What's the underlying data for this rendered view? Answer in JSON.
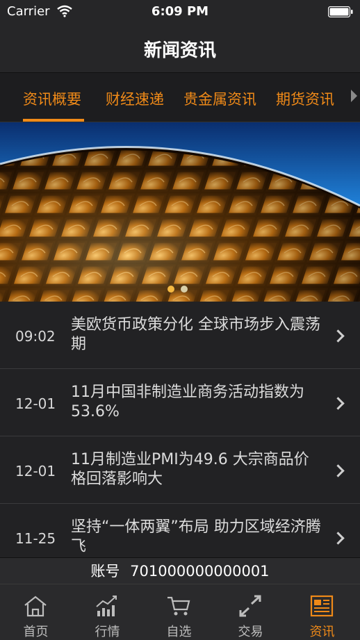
{
  "status_bar": {
    "carrier": "Carrier",
    "time": "6:09 PM"
  },
  "header": {
    "title": "新闻资讯"
  },
  "tabs": [
    {
      "label": "资讯概要",
      "active": true
    },
    {
      "label": "财经速递",
      "active": false
    },
    {
      "label": "贵金属资讯",
      "active": false
    },
    {
      "label": "期货资讯",
      "active": false
    }
  ],
  "banner": {
    "slide_count": 2,
    "active_slide": 1
  },
  "news": [
    {
      "date": "09:02",
      "title": "美欧货币政策分化 全球市场步入震荡期"
    },
    {
      "date": "12-01",
      "title": "11月中国非制造业商务活动指数为53.6%"
    },
    {
      "date": "12-01",
      "title": "11月制造业PMI为49.6 大宗商品价格回落影响大"
    },
    {
      "date": "11-25",
      "title": "坚持“一体两翼”布局 助力区域经济腾飞"
    }
  ],
  "account": {
    "label": "账号",
    "number": "701000000000001"
  },
  "tab_bar": [
    {
      "label": "首页",
      "icon": "home-icon",
      "active": false
    },
    {
      "label": "行情",
      "icon": "chart-icon",
      "active": false
    },
    {
      "label": "自选",
      "icon": "cart-icon",
      "active": false
    },
    {
      "label": "交易",
      "icon": "trade-arrows-icon",
      "active": false
    },
    {
      "label": "资讯",
      "icon": "newspaper-icon",
      "active": true
    }
  ],
  "colors": {
    "accent": "#f08a18",
    "background": "#1c1c1e"
  }
}
